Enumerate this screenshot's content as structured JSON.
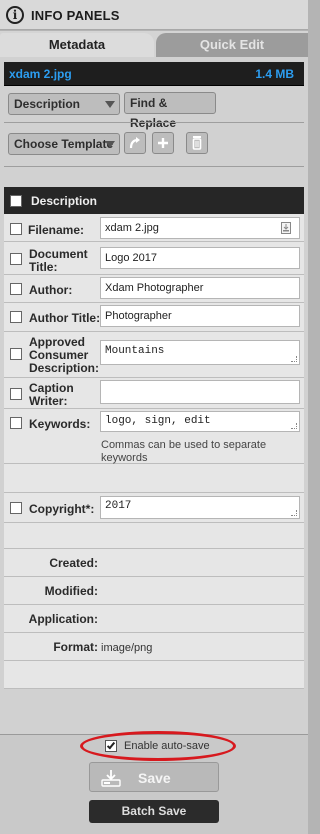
{
  "window": {
    "title": "INFO PANELS"
  },
  "tabs": [
    {
      "label": "Metadata",
      "active": true
    },
    {
      "label": "Quick Edit",
      "active": false
    }
  ],
  "file": {
    "name": "xdam 2.jpg",
    "size": "1.4 MB"
  },
  "toolbar": {
    "view_select": "Description",
    "find_replace_label": "Find & Replace",
    "template_select": "Choose Template"
  },
  "section": {
    "title": "Description"
  },
  "fields": {
    "filename": {
      "label": "Filename:",
      "value": "xdam 2.jpg"
    },
    "document_title": {
      "label": "Document Title:",
      "value": "Logo 2017"
    },
    "author": {
      "label": "Author:",
      "value": "Xdam Photographer"
    },
    "author_title": {
      "label": "Author Title:",
      "value": "Photographer"
    },
    "consumer_description": {
      "label": "Approved Consumer Description:",
      "value": "Mountains"
    },
    "caption_writer": {
      "label": "Caption Writer:",
      "value": ""
    },
    "keywords": {
      "label": "Keywords:",
      "value": "logo, sign, edit",
      "hint": "Commas can be used to separate keywords"
    },
    "copyright": {
      "label": "Copyright*:",
      "value": "2017"
    }
  },
  "info": {
    "created": {
      "label": "Created:",
      "value": ""
    },
    "modified": {
      "label": "Modified:",
      "value": ""
    },
    "application": {
      "label": "Application:",
      "value": ""
    },
    "format": {
      "label": "Format:",
      "value": "image/png"
    }
  },
  "footer": {
    "autosave_label": "Enable auto-save",
    "autosave_checked": true,
    "save_label": "Save",
    "batch_save_label": "Batch Save"
  },
  "colors": {
    "accent": "#2c9df0",
    "highlight_ellipse": "#d7191e"
  }
}
